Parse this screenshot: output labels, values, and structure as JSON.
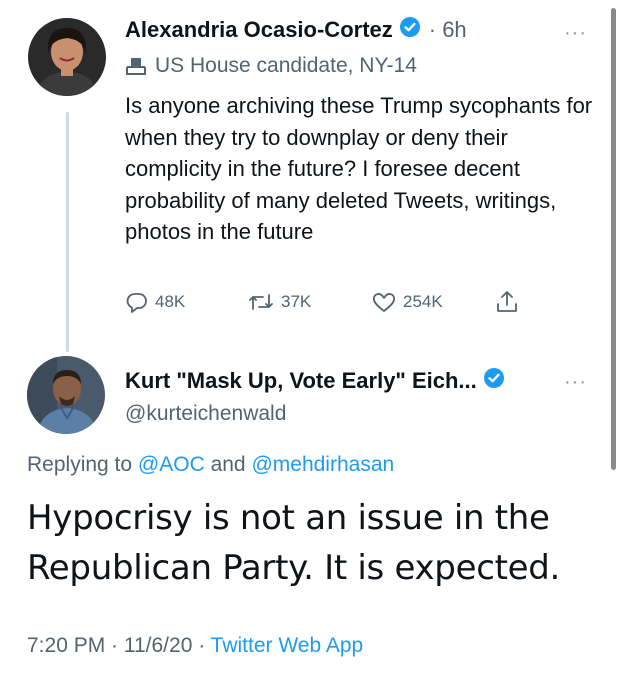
{
  "tweet1": {
    "author_name": "Alexandria Ocasio-Cortez",
    "time": "· 6h",
    "more_label": "···",
    "label": "US House candidate, NY-14",
    "text": "Is anyone archiving these Trump sycophants for when they try to downplay or deny their complicity in the future? I foresee decent probability of many deleted Tweets, writings, photos in the future",
    "replies": "48K",
    "retweets": "37K",
    "likes": "254K"
  },
  "tweet2": {
    "author_name": "Kurt \"Mask Up, Vote Early\" Eich...",
    "more_label": "···",
    "handle": "@kurteichenwald",
    "replying_prefix": "Replying to ",
    "replying_to_1": "@AOC",
    "replying_and": " and ",
    "replying_to_2": "@mehdirhasan",
    "text": "Hypocrisy is not an issue in the Republican Party. It is expected.",
    "timestamp": "7:20 PM · 11/6/20 · ",
    "source": "Twitter Web App"
  },
  "colors": {
    "accent": "#1d9bf0",
    "muted": "#536471",
    "text": "#0f1419"
  },
  "icons": {
    "verified": "verified-badge-icon",
    "candidate_label": "ballot-box-icon",
    "reply": "reply-icon",
    "retweet": "retweet-icon",
    "like": "heart-icon",
    "share": "share-icon",
    "more": "more-icon"
  }
}
